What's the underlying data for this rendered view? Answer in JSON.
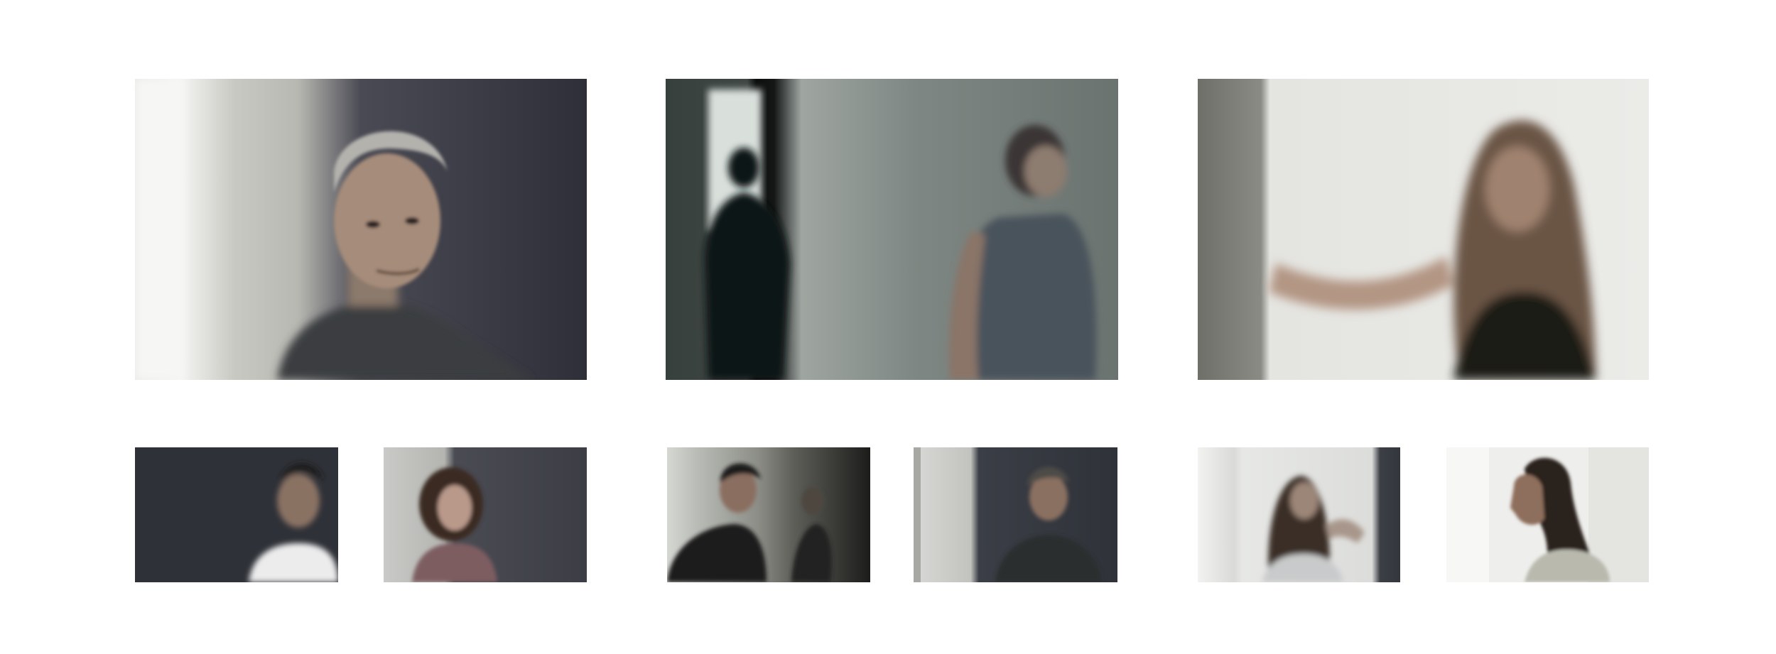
{
  "gallery": {
    "photos": [
      {
        "id": "large-1",
        "subject": "grey-haired-man-portrait",
        "tone": [
          "#2e2f36",
          "#cfcfca"
        ]
      },
      {
        "id": "large-2",
        "subject": "woman-walking-doorway-silhouette",
        "tone": [
          "#5d6462",
          "#1c1f1e"
        ]
      },
      {
        "id": "large-3",
        "subject": "long-haired-woman-reaching-wall",
        "tone": [
          "#e6e6e1",
          "#6e6d66"
        ]
      },
      {
        "id": "small-1",
        "subject": "man-white-tshirt-blurred",
        "tone": [
          "#303238",
          "#e8e8e8"
        ]
      },
      {
        "id": "small-2",
        "subject": "curly-haired-woman",
        "tone": [
          "#b8b9b6",
          "#3f3f48"
        ]
      },
      {
        "id": "small-3",
        "subject": "man-in-doorway-mirror",
        "tone": [
          "#6e706a",
          "#151515"
        ]
      },
      {
        "id": "small-4",
        "subject": "man-grey-wall",
        "tone": [
          "#cfd0cc",
          "#30333a"
        ]
      },
      {
        "id": "small-5",
        "subject": "woman-motion-blur-white-room",
        "tone": [
          "#e3e4e2",
          "#3a3a40"
        ]
      },
      {
        "id": "small-6",
        "subject": "long-haired-man-profile",
        "tone": [
          "#efefed",
          "#2a2420"
        ]
      }
    ]
  }
}
